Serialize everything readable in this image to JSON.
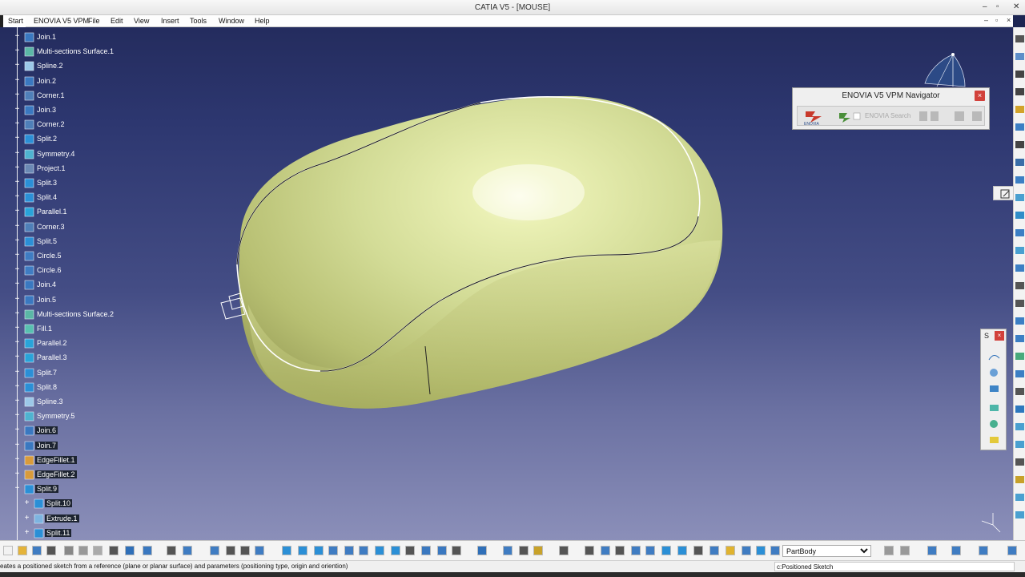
{
  "window": {
    "title": "CATIA V5 - [MOUSE]",
    "controls": {
      "minimize": "–",
      "restore": "▫",
      "close": "✕"
    }
  },
  "menubar": {
    "items": [
      "Start",
      "ENOVIA V5 VPM",
      "File",
      "Edit",
      "View",
      "Insert",
      "Tools",
      "Window",
      "Help"
    ],
    "doc_controls": {
      "minimize": "–",
      "restore": "▫",
      "close": "×"
    }
  },
  "tree": {
    "items": [
      {
        "label": "Join.1",
        "icon": "join-icon",
        "selected": false
      },
      {
        "label": "Multi-sections Surface.1",
        "icon": "multi-sections-surface-icon",
        "selected": false
      },
      {
        "label": "Spline.2",
        "icon": "spline-icon",
        "selected": false
      },
      {
        "label": "Join.2",
        "icon": "join-icon",
        "selected": false
      },
      {
        "label": "Corner.1",
        "icon": "corner-icon",
        "selected": false
      },
      {
        "label": "Join.3",
        "icon": "join-icon",
        "selected": false
      },
      {
        "label": "Corner.2",
        "icon": "corner-icon",
        "selected": false
      },
      {
        "label": "Split.2",
        "icon": "split-icon",
        "selected": false
      },
      {
        "label": "Symmetry.4",
        "icon": "symmetry-icon",
        "selected": false
      },
      {
        "label": "Project.1",
        "icon": "project-icon",
        "selected": false
      },
      {
        "label": "Split.3",
        "icon": "split-icon",
        "selected": false
      },
      {
        "label": "Split.4",
        "icon": "split-icon",
        "selected": false
      },
      {
        "label": "Parallel.1",
        "icon": "parallel-icon",
        "selected": false
      },
      {
        "label": "Corner.3",
        "icon": "corner-icon",
        "selected": false
      },
      {
        "label": "Split.5",
        "icon": "split-icon",
        "selected": false
      },
      {
        "label": "Circle.5",
        "icon": "circle-icon",
        "selected": false
      },
      {
        "label": "Circle.6",
        "icon": "circle-icon",
        "selected": false
      },
      {
        "label": "Join.4",
        "icon": "join-icon",
        "selected": false
      },
      {
        "label": "Join.5",
        "icon": "join-icon",
        "selected": false
      },
      {
        "label": "Multi-sections Surface.2",
        "icon": "multi-sections-surface-icon",
        "selected": false
      },
      {
        "label": "Fill.1",
        "icon": "fill-icon",
        "selected": false
      },
      {
        "label": "Parallel.2",
        "icon": "parallel-icon",
        "selected": false
      },
      {
        "label": "Parallel.3",
        "icon": "parallel-icon",
        "selected": false
      },
      {
        "label": "Split.7",
        "icon": "split-icon",
        "selected": false
      },
      {
        "label": "Split.8",
        "icon": "split-icon",
        "selected": false
      },
      {
        "label": "Spline.3",
        "icon": "spline-icon",
        "selected": false
      },
      {
        "label": "Symmetry.5",
        "icon": "symmetry-icon",
        "selected": false
      },
      {
        "label": "Join.6",
        "icon": "join-icon",
        "selected": true
      },
      {
        "label": "Join.7",
        "icon": "join-icon",
        "selected": true
      },
      {
        "label": "EdgeFillet.1",
        "icon": "edge-fillet-icon",
        "selected": true
      },
      {
        "label": "EdgeFillet.2",
        "icon": "edge-fillet-icon",
        "selected": true
      },
      {
        "label": "Split.9",
        "icon": "split-icon",
        "selected": true
      },
      {
        "label": "Split.10",
        "icon": "split-icon",
        "selected": true
      },
      {
        "label": "Extrude.1",
        "icon": "extrude-icon",
        "selected": true
      },
      {
        "label": "Split.11",
        "icon": "split-icon",
        "selected": true
      }
    ]
  },
  "enovia_navigator": {
    "title": "ENOVIA V5 VPM Navigator",
    "close": "×",
    "logo_text": "ENOVIA",
    "search_label": "ENOVIA Search"
  },
  "sketch_toolbar": {
    "title": "S",
    "close": "×"
  },
  "bottom_toolbar": {
    "current_body": "PartBody",
    "body_options": [
      "PartBody"
    ]
  },
  "status_bar": {
    "message": "eates a positioned sketch from a reference (plane or planar surface) and parameters (positioning type, origin and oriention)",
    "command": "c:Positioned Sketch"
  },
  "colors": {
    "viewport_top": "#242c5e",
    "viewport_bottom": "#8b8fb9",
    "part_surface": "#d6de9a",
    "selection_highlight": "#1d2431"
  }
}
